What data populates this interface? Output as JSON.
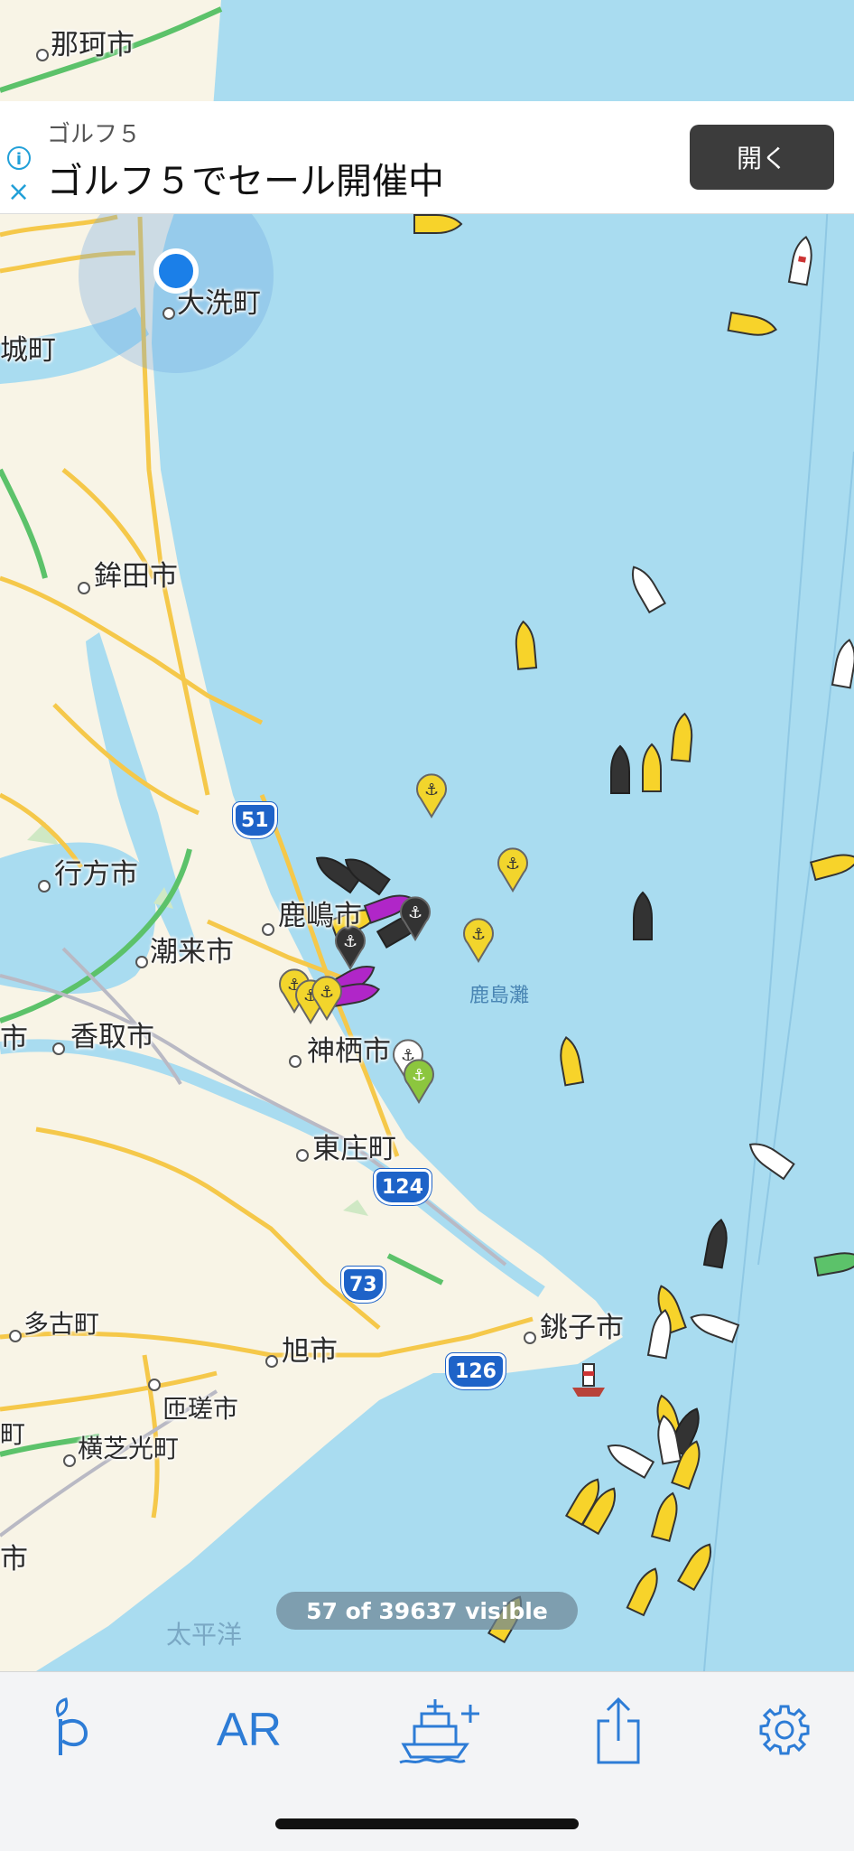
{
  "map": {
    "places": [
      {
        "name": "那珂市",
        "key": "naka"
      },
      {
        "name": "大洗町",
        "key": "oarai"
      },
      {
        "name": "城町",
        "key": "shiro"
      },
      {
        "name": "鉾田市",
        "key": "hokota"
      },
      {
        "name": "行方市",
        "key": "namegata"
      },
      {
        "name": "鹿嶋市",
        "key": "kashima"
      },
      {
        "name": "潮来市",
        "key": "itako"
      },
      {
        "name": "香取市",
        "key": "katori"
      },
      {
        "name": "神栖市",
        "key": "kamisu"
      },
      {
        "name": "東庄町",
        "key": "tonosho"
      },
      {
        "name": "銚子市",
        "key": "choshi"
      },
      {
        "name": "多古町",
        "key": "tako"
      },
      {
        "name": "旭市",
        "key": "asahi"
      },
      {
        "name": "匝瑳市",
        "key": "sosa"
      },
      {
        "name": "横芝光町",
        "key": "yokoshibahikari"
      },
      {
        "name": "町",
        "key": "machi-edge"
      },
      {
        "name": "市",
        "key": "shi-edge"
      },
      {
        "name": "市",
        "key": "shi-edge2"
      }
    ],
    "sea_labels": [
      "鹿島灘",
      "太平洋"
    ],
    "routes": [
      "51",
      "124",
      "73",
      "126"
    ],
    "colors": {
      "sea": "#a9dcf0",
      "land": "#f8f4e6",
      "road_yellow": "#f5c84a",
      "highway_green": "#5cc26a",
      "location_blue": "#1b7fe8"
    }
  },
  "ad": {
    "brand": "ゴルフ５",
    "headline": "ゴルフ５でセール開催中",
    "button": "開く",
    "info_icon": "i",
    "close_icon": "×"
  },
  "counter": "57 of 39637 visible",
  "tabbar": {
    "tabs": [
      {
        "name": "tab-pro",
        "icon": "pro-leaf-icon"
      },
      {
        "name": "tab-ar",
        "label": "AR"
      },
      {
        "name": "tab-add-ship",
        "icon": "ship-add-icon"
      },
      {
        "name": "tab-share",
        "icon": "share-icon"
      },
      {
        "name": "tab-settings",
        "icon": "gear-icon"
      }
    ]
  }
}
